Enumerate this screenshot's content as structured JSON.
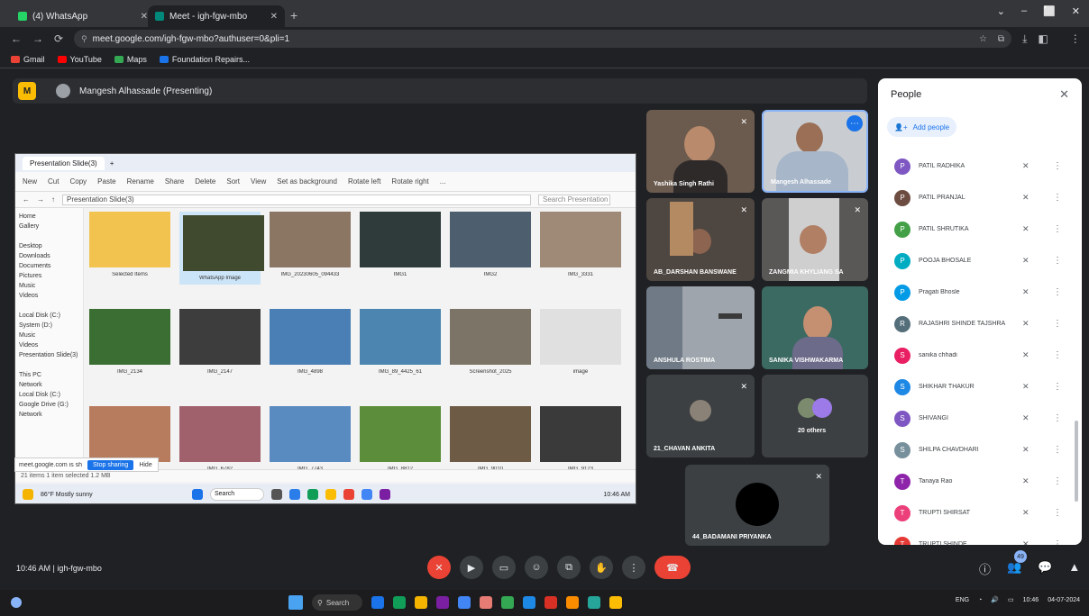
{
  "browser": {
    "tabs": [
      {
        "label": "(4) WhatsApp",
        "color": "#25d366"
      },
      {
        "label": "Meet - igh-fgw-mbo",
        "color": "#00897b"
      }
    ],
    "new_tab": "+",
    "window_controls": [
      "‒",
      "–",
      "⬜",
      "✕"
    ],
    "nav_icons": [
      "←",
      "→",
      "C"
    ],
    "url": "meet.google.com/igh-fgw-mbo?authuser=0&pli=1",
    "toolbar_icons": [
      "☆",
      "⋮"
    ],
    "bookmarks": [
      {
        "label": "Gmail",
        "color": "#ea4335"
      },
      {
        "label": "YouTube",
        "color": "#ff0000"
      },
      {
        "label": "Maps",
        "color": "#34a853"
      },
      {
        "label": "Foundation Repairs...",
        "color": "#1a73e8"
      }
    ]
  },
  "presenter": {
    "logo": "M",
    "text": "Mangesh Alhassade (Presenting)"
  },
  "explorer": {
    "title": "Presentation Slide(3)",
    "toolbar": [
      "New",
      "Cut",
      "Copy",
      "Paste",
      "Rename",
      "Share",
      "Delete",
      "Sort",
      "View",
      "Set as background",
      "Rotate left",
      "Rotate right",
      "..."
    ],
    "path": "Presentation Slide(3)",
    "search_placeholder": "Search Presentation",
    "sidebar": [
      "Home",
      "Gallery",
      "",
      "Desktop",
      "Downloads",
      "Documents",
      "Pictures",
      "Music",
      "Videos",
      "",
      "Local Disk (C:)",
      "System (D:)",
      "Music",
      "Videos",
      "Presentation Slide(3)",
      "",
      "This PC",
      "Network",
      "Local Disk (C:)",
      "Google Drive (G:)",
      "Network"
    ],
    "files": [
      {
        "name": "Selected Items",
        "color": "#f2c44f"
      },
      {
        "name": "WhatsApp Image",
        "color": "#3f4a2e"
      },
      {
        "name": "IMG_20230605_094433",
        "color": "#8a7662"
      },
      {
        "name": "IMG1",
        "color": "#2f3a3a"
      },
      {
        "name": "IMG2",
        "color": "#4d5f6f"
      },
      {
        "name": "IMG_3331",
        "color": "#9e8a76"
      },
      {
        "name": "IMG_2134",
        "color": "#3b6e32"
      },
      {
        "name": "IMG_2147",
        "color": "#3d3d3d"
      },
      {
        "name": "IMG_4898",
        "color": "#4a7fb6"
      },
      {
        "name": "IMG_89_4425_61",
        "color": "#4c86b0"
      },
      {
        "name": "Screenshot_2025",
        "color": "#7c7466"
      },
      {
        "name": "image",
        "color": "#e0e0e0"
      },
      {
        "name": "IMG_5543",
        "color": "#b77b5e"
      },
      {
        "name": "IMG_6782",
        "color": "#a1616c"
      },
      {
        "name": "IMG_7743",
        "color": "#5a8bc0"
      },
      {
        "name": "IMG_8812",
        "color": "#5b8d3a"
      },
      {
        "name": "IMG_9010",
        "color": "#6e5b46"
      },
      {
        "name": "IMG_9123",
        "color": "#3a3a3a"
      }
    ],
    "status": "21 items   1 item selected   1.2 MB",
    "popup_text": "meet.google.com is sharing your screen.",
    "popup_button": "Stop sharing",
    "popup_hide": "Hide",
    "taskbar_search": "Search",
    "taskbar_app": "86°F Mostly sunny",
    "taskbar_time": "10:46 AM"
  },
  "tiles": [
    {
      "name": "Yashika Singh Rathi",
      "mic": "✕"
    },
    {
      "name": "Mangesh Alhassade",
      "mic": "⋯"
    },
    {
      "name": "AB_DARSHAN BANSWANE",
      "mic": "✕"
    },
    {
      "name": "ZANGMIA KHYLIANG SA",
      "mic": "✕"
    },
    {
      "name": "ANSHULA ROSTIMA",
      "mic": ""
    },
    {
      "name": "SANIKA VISHWAKARMA",
      "mic": ""
    },
    {
      "name": "21_CHAVAN ANKITA",
      "mic": "✕"
    },
    {
      "name": "20 others",
      "mic": ""
    },
    {
      "name": "44_BADAMANI PRIYANKA",
      "mic": "✕"
    }
  ],
  "people": {
    "title": "People",
    "close": "✕",
    "add_label": "Add people",
    "list": [
      {
        "initial": "P",
        "name": "PATIL RADHIKA",
        "color": "#7e57c2"
      },
      {
        "initial": "P",
        "name": "PATIL PRANJAL",
        "color": "#6d4c41"
      },
      {
        "initial": "P",
        "name": "PATIL SHRUTIKA",
        "color": "#43a047"
      },
      {
        "initial": "P",
        "name": "POOJA BHOSALE",
        "color": "#00acc1"
      },
      {
        "initial": "P",
        "name": "Pragati Bhosle",
        "color": "#039be5"
      },
      {
        "initial": "R",
        "name": "RAJASHRI SHINDE TAJSHRA",
        "color": "#546e7a"
      },
      {
        "initial": "S",
        "name": "sanika chhadi",
        "color": "#e91e63"
      },
      {
        "initial": "S",
        "name": "SHIKHAR THAKUR",
        "color": "#1e88e5"
      },
      {
        "initial": "S",
        "name": "SHIVANGI",
        "color": "#7e57c2"
      },
      {
        "initial": "S",
        "name": "SHILPA CHAVDHARI",
        "color": "#78909c"
      },
      {
        "initial": "T",
        "name": "Tanaya Rao",
        "color": "#8e24aa"
      },
      {
        "initial": "T",
        "name": "TRUPTI SHIRSAT",
        "color": "#ec407a"
      },
      {
        "initial": "T",
        "name": "TRUPTI SHINDE",
        "color": "#e53935"
      }
    ],
    "mic_icon": "✕",
    "more_icon": "⋮"
  },
  "footer": {
    "meeting_info": "10:46 AM  |  igh-fgw-mbo",
    "people_count": "49",
    "controls": [
      {
        "name": "mic-button",
        "glyph": "✕",
        "red": true
      },
      {
        "name": "camera-button",
        "glyph": "▶",
        "red": false
      },
      {
        "name": "captions-button",
        "glyph": "▭",
        "red": false
      },
      {
        "name": "emoji-button",
        "glyph": "☺",
        "red": false
      },
      {
        "name": "present-button",
        "glyph": "⧉",
        "red": false
      },
      {
        "name": "hand-button",
        "glyph": "✋",
        "red": false
      },
      {
        "name": "more-button",
        "glyph": "⋮",
        "red": false
      }
    ],
    "end_call": "☎",
    "right_icons": [
      "ⓘ",
      "👥",
      "💬",
      "▲"
    ]
  },
  "windows_taskbar": {
    "search": "Search",
    "time": "10:46",
    "date": "04-07-2024",
    "lang": "ENG"
  }
}
